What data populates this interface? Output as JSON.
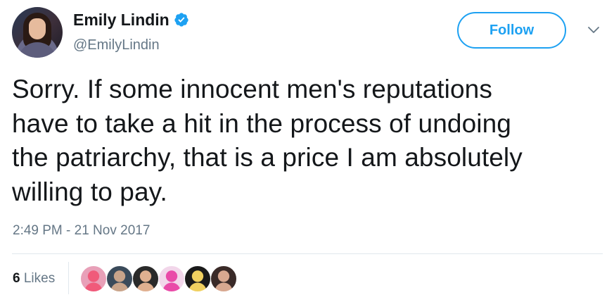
{
  "author": {
    "display_name": "Emily Lindin",
    "handle": "@EmilyLindin",
    "verified": true
  },
  "actions": {
    "follow_label": "Follow",
    "menu_icon": "chevron-down-icon"
  },
  "tweet": {
    "lines": [
      "Sorry. If some innocent men's reputations",
      "have to take a hit in the process of undoing",
      "the patriarchy, that is a price I am absolutely",
      "willing to pay."
    ],
    "timestamp": "2:49 PM - 21 Nov 2017"
  },
  "stats": {
    "likes_count": "6",
    "likes_label": "Likes"
  },
  "colors": {
    "brand_blue": "#1da1f2",
    "text_primary": "#14171a",
    "text_secondary": "#657786",
    "divider": "#e1e8ed"
  },
  "likers": [
    {
      "name": "liker-avatar-1",
      "color": "#e8a0b8",
      "accent": "#f05a7a"
    },
    {
      "name": "liker-avatar-2",
      "color": "#3a4a5a",
      "accent": "#c9a48a"
    },
    {
      "name": "liker-avatar-3",
      "color": "#2a2a2a",
      "accent": "#e0b090"
    },
    {
      "name": "liker-avatar-4",
      "color": "#f2d6ea",
      "accent": "#e94aa8"
    },
    {
      "name": "liker-avatar-5",
      "color": "#1a1a1a",
      "accent": "#f0d060"
    },
    {
      "name": "liker-avatar-6",
      "color": "#3a2a28",
      "accent": "#d8a890"
    }
  ]
}
